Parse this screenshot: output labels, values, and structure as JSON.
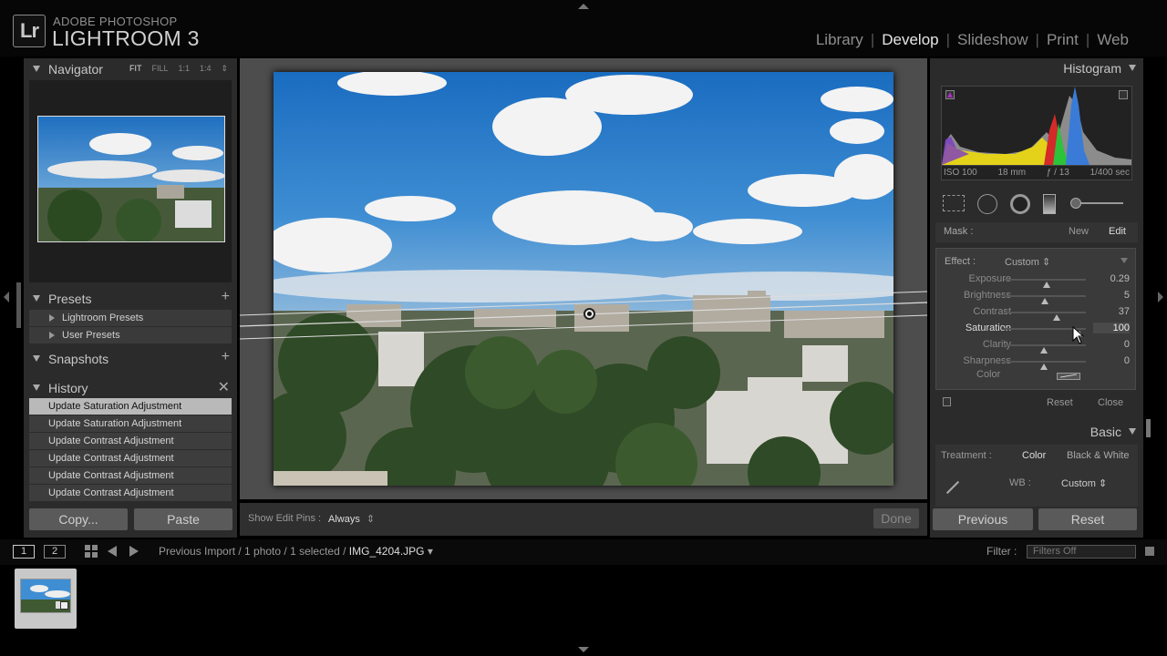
{
  "app": {
    "brand_small": "ADOBE PHOTOSHOP",
    "brand_big": "LIGHTROOM 3",
    "logo": "Lr"
  },
  "modules": [
    "Library",
    "Develop",
    "Slideshow",
    "Print",
    "Web"
  ],
  "active_module": "Develop",
  "left": {
    "navigator": {
      "title": "Navigator",
      "zoom": [
        "FIT",
        "FILL",
        "1:1",
        "1:4"
      ]
    },
    "presets": {
      "title": "Presets",
      "items": [
        "Lightroom Presets",
        "User Presets"
      ]
    },
    "snapshots": {
      "title": "Snapshots"
    },
    "history": {
      "title": "History",
      "items": [
        "Update Saturation Adjustment",
        "Update Saturation Adjustment",
        "Update Contrast Adjustment",
        "Update Contrast Adjustment",
        "Update Contrast Adjustment",
        "Update Contrast Adjustment"
      ]
    },
    "copy_label": "Copy...",
    "paste_label": "Paste"
  },
  "center": {
    "show_edit_pins_label": "Show Edit Pins :",
    "show_edit_pins_value": "Always",
    "done_label": "Done"
  },
  "right": {
    "histogram": {
      "title": "Histogram",
      "iso": "ISO 100",
      "focal": "18 mm",
      "aperture": "ƒ / 13",
      "shutter": "1/400 sec"
    },
    "mask": {
      "label": "Mask :",
      "new": "New",
      "edit": "Edit"
    },
    "effect": {
      "label": "Effect :",
      "value": "Custom"
    },
    "adjustments": [
      {
        "label": "Exposure",
        "value": "0.29",
        "level": 0.52
      },
      {
        "label": "Brightness",
        "value": "5",
        "level": 0.5
      },
      {
        "label": "Contrast",
        "value": "37",
        "level": 0.64
      },
      {
        "label": "Saturation",
        "value": "100",
        "level": 0.92
      },
      {
        "label": "Clarity",
        "value": "0",
        "level": 0.49
      },
      {
        "label": "Sharpness",
        "value": "0",
        "level": 0.49
      }
    ],
    "color_label": "Color",
    "reset_label": "Reset",
    "close_label": "Close",
    "basic": {
      "title": "Basic",
      "treatment_label": "Treatment :",
      "color": "Color",
      "bw": "Black & White",
      "wb_label": "WB :",
      "wb_value": "Custom"
    },
    "previous_label": "Previous",
    "reset_button_label": "Reset"
  },
  "filmstrip": {
    "screen1": "1",
    "screen2": "2",
    "crumb_prefix": "Previous Import / 1 photo / 1 selected /",
    "filename": "IMG_4204.JPG",
    "filter_label": "Filter :",
    "filter_value": "Filters Off"
  },
  "colors": {
    "panel": "#2b2b2b",
    "center_bg": "#4d4d4d",
    "sky_top": "#1f6fc0",
    "history_selected": "#b9b9b9"
  }
}
